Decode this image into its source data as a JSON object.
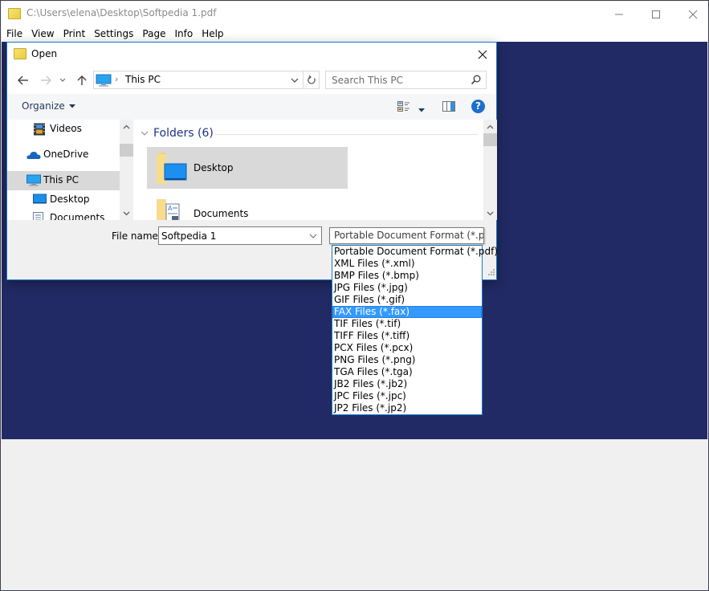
{
  "window": {
    "title": "C:\\Users\\elena\\Desktop\\Softpedia 1.pdf",
    "controls": {
      "minimize": "minimize",
      "maximize": "maximize",
      "close": "close"
    }
  },
  "menu": [
    "File",
    "View",
    "Print",
    "Settings",
    "Page",
    "Info",
    "Help"
  ],
  "dialog": {
    "title": "Open",
    "nav": {
      "back_icon": "arrow-left-icon",
      "forward_icon": "arrow-right-icon",
      "recent_icon": "chevron-down-icon",
      "up_icon": "arrow-up-icon"
    },
    "address": {
      "location": "This PC",
      "icon": "computer-icon"
    },
    "search": {
      "placeholder": "Search This PC"
    },
    "toolbar": {
      "organize_label": "Organize",
      "help_label": "?"
    },
    "nav_pane": {
      "items": [
        {
          "label": "Videos",
          "icon": "videos-icon",
          "selected": false
        },
        {
          "label": "OneDrive",
          "icon": "cloud-icon",
          "selected": false
        },
        {
          "label": "This PC",
          "icon": "computer-icon",
          "selected": true
        },
        {
          "label": "Desktop",
          "icon": "desktop-icon",
          "selected": false
        },
        {
          "label": "Documents",
          "icon": "documents-icon",
          "selected": false
        }
      ]
    },
    "content": {
      "group_header": "Folders (6)",
      "folders": [
        {
          "label": "Desktop",
          "selected": true
        },
        {
          "label": "Documents",
          "selected": false
        }
      ]
    },
    "footer": {
      "file_name_label": "File name:",
      "file_name_value": "Softpedia 1",
      "file_type_value": "Portable Document Format (*.pdf)"
    }
  },
  "file_types": {
    "options": [
      "Portable Document Format (*.pdf)",
      "XML Files (*.xml)",
      "BMP Files (*.bmp)",
      "JPG Files (*.jpg)",
      "GIF Files (*.gif)",
      "FAX Files (*.fax)",
      "TIF Files (*.tif)",
      "TIFF Files (*.tiff)",
      "PCX Files (*.pcx)",
      "PNG Files (*.png)",
      "TGA Files (*.tga)",
      "JB2 Files (*.jb2)",
      "JPC Files (*.jpc)",
      "JP2 Files (*.jp2)"
    ],
    "highlighted_index": 5
  },
  "colors": {
    "canvas_bg": "#212a64",
    "accent": "#1979ca",
    "highlight": "#3399ff",
    "group_header": "#1e3287"
  }
}
